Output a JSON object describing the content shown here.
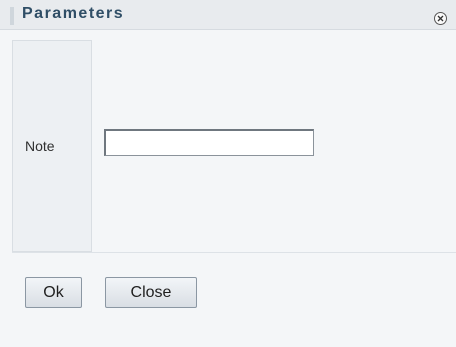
{
  "dialog": {
    "title": "Parameters",
    "close_icon": "close-icon"
  },
  "form": {
    "note_label": "Note",
    "note_value": "",
    "note_placeholder": ""
  },
  "buttons": {
    "ok_label": "Ok",
    "close_label": "Close"
  }
}
